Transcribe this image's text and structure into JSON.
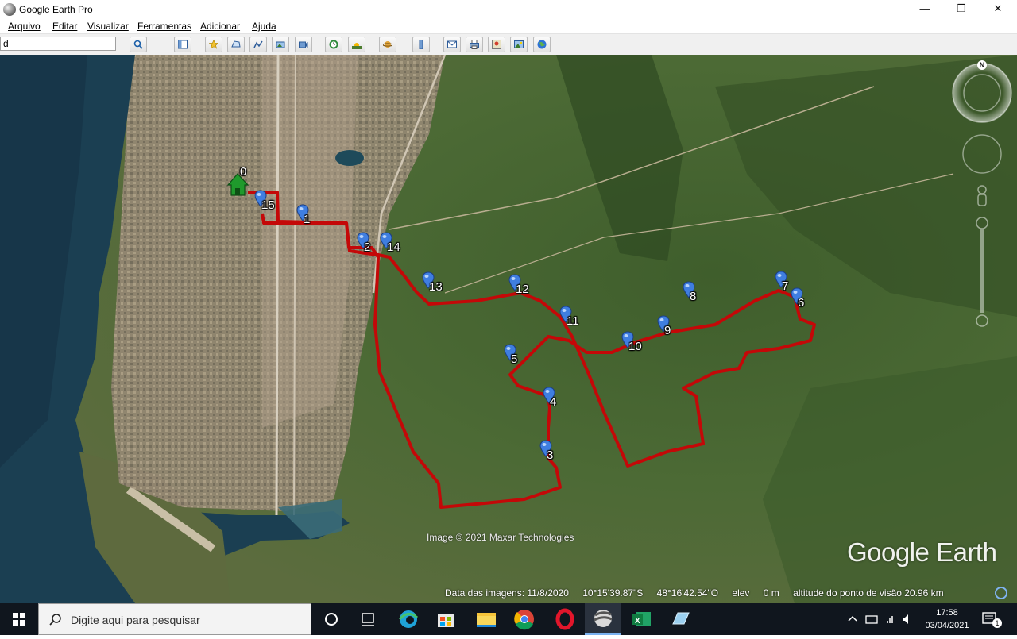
{
  "window": {
    "title": "Google Earth Pro",
    "minimize": "—",
    "maximize": "❐",
    "close": "✕"
  },
  "menu": [
    "Arquivo",
    "Editar",
    "Visualizar",
    "Ferramentas",
    "Adicionar",
    "Ajuda"
  ],
  "search": {
    "value": "d"
  },
  "toolbar": {
    "icons": [
      "search-icon",
      "sidebar-icon",
      "placemark-icon",
      "polygon-icon",
      "path-icon",
      "overlay-icon",
      "tour-icon",
      "history-icon",
      "sunlight-icon",
      "planets-icon",
      "ruler-icon",
      "email-icon",
      "print-icon",
      "save-image-icon",
      "view-in-maps-icon",
      "earth-gallery-icon"
    ]
  },
  "map": {
    "start_label": "0",
    "placemarks": [
      "1",
      "2",
      "3",
      "4",
      "5",
      "6",
      "7",
      "8",
      "9",
      "10",
      "11",
      "12",
      "13",
      "14",
      "15"
    ],
    "route_color": "#c40808",
    "imagery_credit": "Image © 2021 Maxar Technologies",
    "watermark": "Google Earth",
    "compass_label": "N"
  },
  "status": {
    "imagery_date": "Data das imagens: 11/8/2020",
    "latitude": "10°15'39.87\"S",
    "longitude": "48°16'42.54\"O",
    "elevation_label": "elev",
    "elevation_value": "0 m",
    "eye_altitude": "altitude do ponto de visão  20.96 km"
  },
  "taskbar": {
    "search_placeholder": "Digite aqui para pesquisar",
    "time": "17:58",
    "date": "03/04/2021",
    "notification_count": "1"
  }
}
